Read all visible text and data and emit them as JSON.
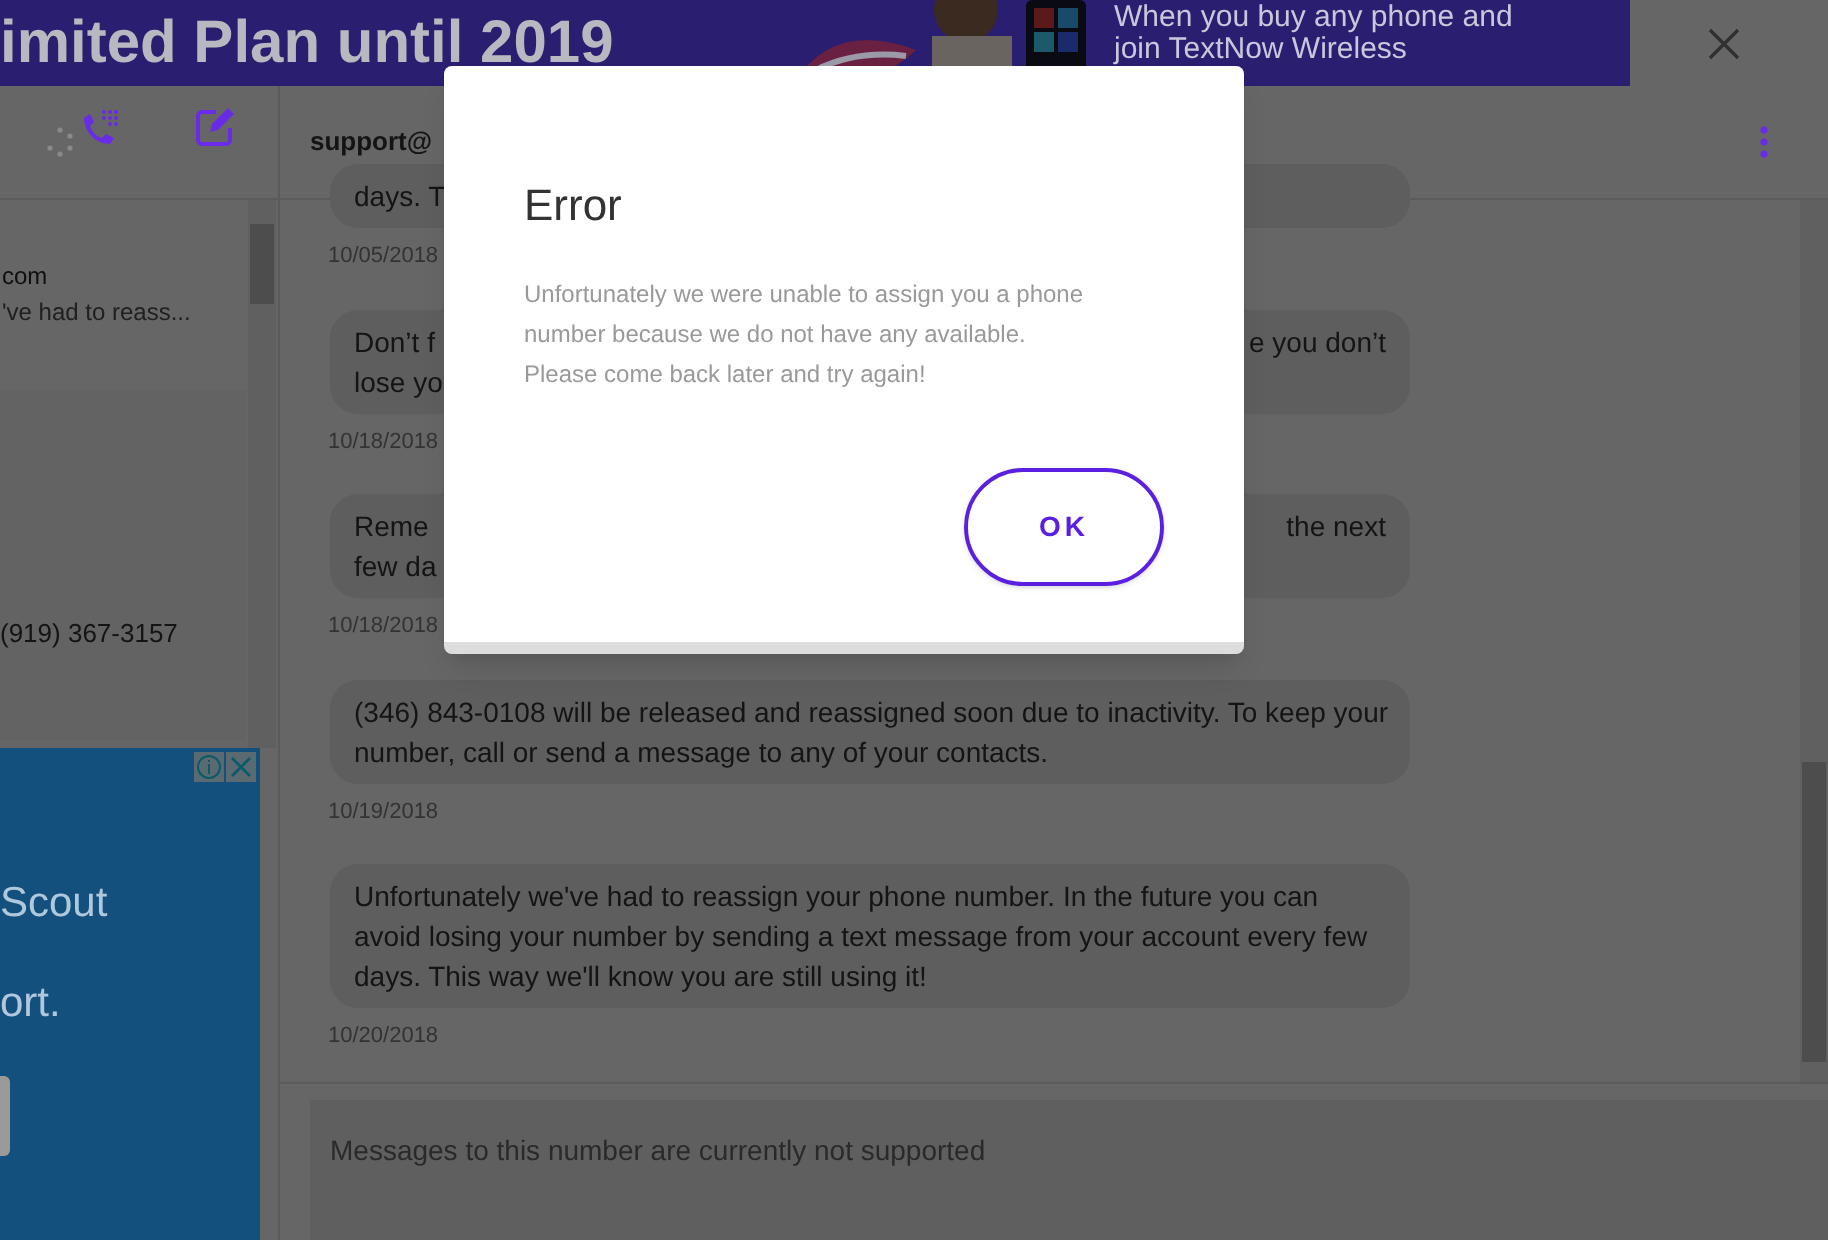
{
  "banner": {
    "headline": "imited Plan until 2019",
    "tagline": [
      "When you buy any phone and",
      "join TextNow Wireless"
    ]
  },
  "header": {
    "contact": "support@"
  },
  "conversation": {
    "title": "com",
    "preview": "'ve had to reass..."
  },
  "contact_panel": {
    "phone": "(919) 367-3157"
  },
  "ad": {
    "lines": [
      "Scout",
      "ort."
    ]
  },
  "messages": [
    {
      "lines": [
        [
          "days. T"
        ]
      ],
      "date": "10/05/2018"
    },
    {
      "lines": [
        [
          "Don’t f",
          "e you don’t"
        ],
        [
          "lose yo"
        ]
      ],
      "date": "10/18/2018"
    },
    {
      "lines": [
        [
          "Reme",
          "the next"
        ],
        [
          "few da"
        ]
      ],
      "date": "10/18/2018"
    },
    {
      "lines": [
        [
          "(346) 843-0108 will be released and reassigned soon due to inactivity. To keep your"
        ],
        [
          "number, call or send a message to any of your contacts."
        ]
      ],
      "date": "10/19/2018"
    },
    {
      "lines": [
        [
          "Unfortunately we've had to reassign your phone number. In the future you can"
        ],
        [
          "avoid losing your number by sending a text message from your account every few"
        ],
        [
          "days. This way we'll know you are still using it!"
        ]
      ],
      "date": "10/20/2018"
    }
  ],
  "composer": {
    "placeholder": "Messages to this number are currently not supported"
  },
  "dialog": {
    "title": "Error",
    "body": [
      "Unfortunately we were unable to assign you a phone",
      "number because we do not have any available.",
      "Please come back later and try again!"
    ],
    "button": "OK"
  }
}
